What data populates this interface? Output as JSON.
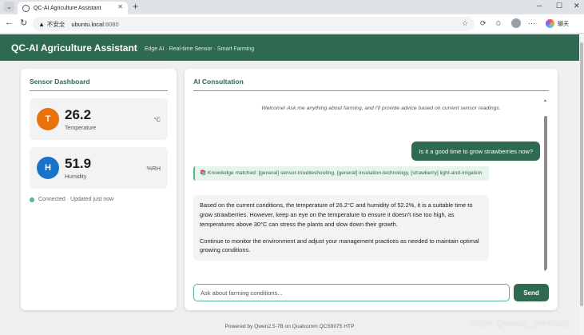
{
  "browser": {
    "tab_title": "QC-AI Agriculture Assistant",
    "insecure_label": "不安全",
    "url_host": "ubuntu.local",
    "url_port": ":8080",
    "copilot_label": "聊天"
  },
  "app": {
    "title": "QC-AI Agriculture Assistant",
    "subtitle": "Edge AI · Real-time Sensor · Smart Farming"
  },
  "sensor_panel": {
    "title": "Sensor Dashboard",
    "temperature": {
      "badge": "T",
      "value": "26.2",
      "label": "Temperature",
      "unit": "°C",
      "color": "#e8710a"
    },
    "humidity": {
      "badge": "H",
      "value": "51.9",
      "label": "Humidity",
      "unit": "%RH",
      "color": "#1a73c9"
    },
    "status": "Connected · Updated just now"
  },
  "ai_panel": {
    "title": "AI Consultation",
    "welcome": "Welcome! Ask me anything about farming, and I'll provide advice based on current sensor readings.",
    "user_message": "Is it a good time to grow strawberries now?",
    "knowledge_note": "📚 Knowledge matched: [general] sensor-troubleshooting, [general] insulation-technology, [strawberry] light-and-irrigation",
    "ai_reply_p1": "Based on the current conditions, the temperature of 26.2°C and humidity of 52.2%, it is a suitable time to grow strawberries. However, keep an eye on the temperature to ensure it doesn't rise too high, as temperatures above 30°C can stress the plants and slow down their growth.",
    "ai_reply_p2": "Continue to monitor the environment and adjust your management practices as needed to maintain optimal growing conditions.",
    "input_placeholder": "Ask about farming conditions...",
    "send_label": "Send"
  },
  "footer": "Powered by Qwen2.5-7B on Qualcomm QCS9075 HTP",
  "watermark": "CSDN @weixin_38498942",
  "colors": {
    "brand": "#2d6a4f",
    "accent": "#52b788"
  }
}
